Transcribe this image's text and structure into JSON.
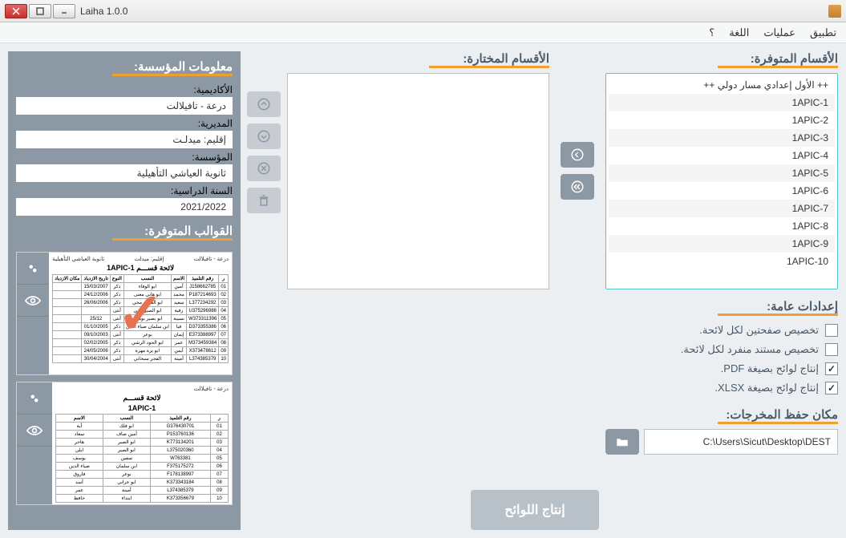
{
  "window": {
    "title": "Laiha 1.0.0"
  },
  "menu": {
    "app": "تطبيق",
    "ops": "عمليات",
    "lang": "اللغة",
    "help": "؟"
  },
  "sections": {
    "available": "الأقسام المتوفرة:",
    "selected": "الأقسام المختارة:",
    "general": "إعدادات عامة:",
    "output": "مكان حفظ المخرجات:",
    "info": "معلومات المؤسسة:",
    "templates": "القوالب المتوفرة:"
  },
  "classes": [
    "++ الأول إعدادي مسار دولي ++",
    "1APIC-1",
    "1APIC-2",
    "1APIC-3",
    "1APIC-4",
    "1APIC-5",
    "1APIC-6",
    "1APIC-7",
    "1APIC-8",
    "1APIC-9",
    "1APIC-10"
  ],
  "options": {
    "two_pages": "تخصيص صفحتين لكل لائحة.",
    "sep_doc": "تخصيص مستند منفرد لكل لائحة.",
    "pdf": "إنتاج لوائح بصيغة PDF.",
    "xlsx": "إنتاج لوائح بصيغة XLSX."
  },
  "output_path": "C:\\Users\\Sicut\\Desktop\\DEST",
  "info": {
    "academy_lbl": "الأكاديمية:",
    "academy_val": "درعة - تافيلالت",
    "dir_lbl": "المديرية:",
    "dir_val": "إقليم: ميدلـت",
    "school_lbl": "المؤسسة:",
    "school_val": "ثانوية العياشي التأهيلية",
    "year_lbl": "السنة الدراسية:",
    "year_val": "2021/2022"
  },
  "template": {
    "t1_title": "لائحة قســـم 1APIC-1",
    "t2_title": "لائحة قســـم",
    "t2_sub": "1APIC-1",
    "hdr_left": "درعة - تافيلالت",
    "hdr_mid": "إقليم: ميدلت",
    "hdr_right": "ثانوية العياشي التأهيلية"
  },
  "generate": "إنتاج اللوائح"
}
